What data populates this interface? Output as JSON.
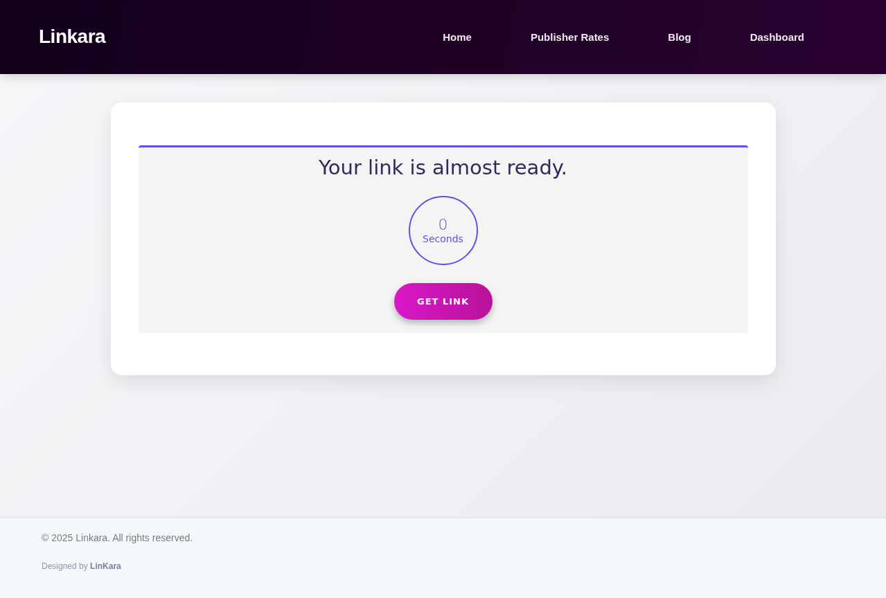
{
  "header": {
    "logo": "Linkara",
    "nav": [
      "Home",
      "Publisher Rates",
      "Blog",
      "Dashboard"
    ]
  },
  "card": {
    "title": "Your link is almost ready.",
    "countdown": {
      "value": "0",
      "unit": "Seconds"
    },
    "button": "GET LINK"
  },
  "footer": {
    "copyright": "© 2025 Linkara. All rights reserved.",
    "credit": "Designed by **LinKara**"
  }
}
